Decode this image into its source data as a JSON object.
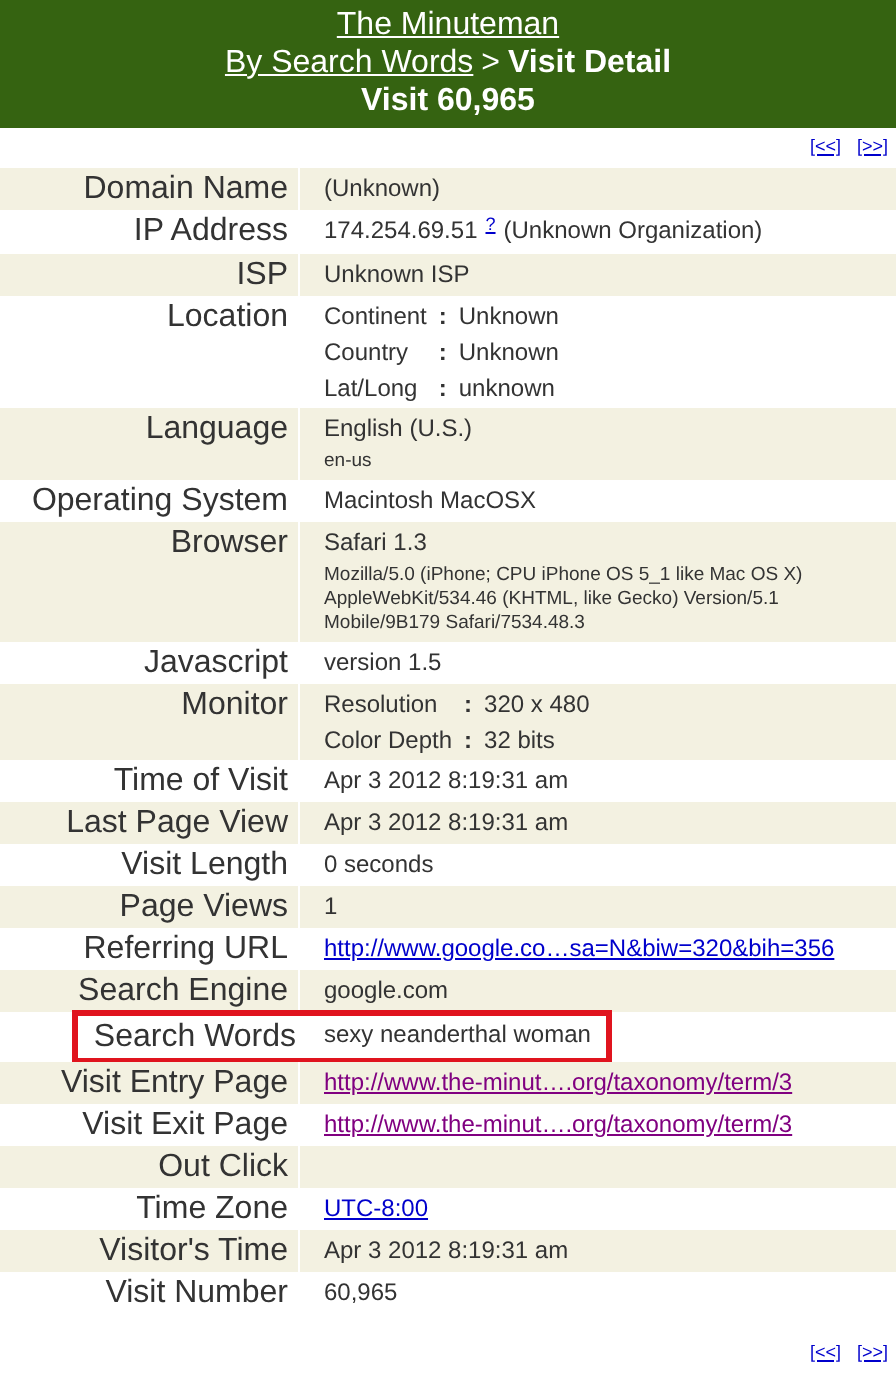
{
  "header": {
    "site_link": "The Minuteman",
    "breadcrumb_link": "By Search Words",
    "separator": ">",
    "current": "Visit Detail",
    "subtitle": "Visit 60,965"
  },
  "nav_top": {
    "prev": "[<<]",
    "next": "[>>]"
  },
  "rows": [
    {
      "label": "Domain Name",
      "kind": "text",
      "value": "(Unknown)",
      "highlighted": false
    },
    {
      "label": "IP Address",
      "kind": "ip",
      "value": "174.254.69.51",
      "help": "?",
      "org": "(Unknown Organization)",
      "highlighted": false
    },
    {
      "label": "ISP",
      "kind": "text",
      "value": "Unknown ISP",
      "highlighted": false
    },
    {
      "label": "Location",
      "kind": "pairs",
      "pairs": [
        {
          "key": "Continent",
          "sep": ":",
          "value": "Unknown"
        },
        {
          "key": "Country",
          "sep": ":",
          "value": "Unknown"
        },
        {
          "key": "Lat/Long",
          "sep": ":",
          "value": "unknown"
        }
      ],
      "highlighted": false
    },
    {
      "label": "Language",
      "kind": "text",
      "value": "English (U.S.)",
      "details": [
        "en-us"
      ],
      "highlighted": false
    },
    {
      "label": "Operating System",
      "kind": "text",
      "value": "Macintosh MacOSX",
      "highlighted": false
    },
    {
      "label": "Browser",
      "kind": "text",
      "value": "Safari 1.3",
      "details": [
        "Mozilla/5.0 (iPhone; CPU iPhone OS 5_1 like Mac OS X)",
        "AppleWebKit/534.46 (KHTML, like Gecko) Version/5.1",
        "Mobile/9B179 Safari/7534.48.3"
      ],
      "highlighted": false
    },
    {
      "label": "Javascript",
      "kind": "text",
      "value": "version 1.5",
      "highlighted": false
    },
    {
      "label": "Monitor",
      "kind": "pairs",
      "pairs": [
        {
          "key": "Resolution",
          "sep": ":",
          "value": "320 x 480"
        },
        {
          "key": "Color Depth",
          "sep": ":",
          "value": "32 bits"
        }
      ],
      "highlighted": false
    },
    {
      "label": "Time of Visit",
      "kind": "text",
      "value": "Apr 3 2012 8:19:31 am",
      "highlighted": false
    },
    {
      "label": "Last Page View",
      "kind": "text",
      "value": "Apr 3 2012 8:19:31 am",
      "highlighted": false
    },
    {
      "label": "Visit Length",
      "kind": "text",
      "value": "0 seconds",
      "highlighted": false
    },
    {
      "label": "Page Views",
      "kind": "text",
      "value": "1",
      "highlighted": false
    },
    {
      "label": "Referring URL",
      "kind": "link",
      "value": "http://www.google.co…sa=N&biw=320&bih=356",
      "visited": false,
      "highlighted": false
    },
    {
      "label": "Search Engine",
      "kind": "text",
      "value": "google.com",
      "highlighted": false
    },
    {
      "label": "Search Words",
      "kind": "text",
      "value": "sexy neanderthal woman",
      "highlighted": true
    },
    {
      "label": "Visit Entry Page",
      "kind": "link",
      "value": "http://www.the-minut….org/taxonomy/term/3",
      "visited": true,
      "highlighted": false
    },
    {
      "label": "Visit Exit Page",
      "kind": "link",
      "value": "http://www.the-minut….org/taxonomy/term/3",
      "visited": true,
      "highlighted": false
    },
    {
      "label": "Out Click",
      "kind": "empty",
      "highlighted": false
    },
    {
      "label": "Time Zone",
      "kind": "link",
      "value": "UTC-8:00",
      "visited": false,
      "highlighted": false
    },
    {
      "label": "Visitor's Time",
      "kind": "text",
      "value": "Apr 3 2012 8:19:31 am",
      "highlighted": false
    },
    {
      "label": "Visit Number",
      "kind": "text",
      "value": "60,965",
      "highlighted": false
    }
  ],
  "nav_bottom": {
    "prev": "[<<]",
    "next": "[>>]"
  }
}
